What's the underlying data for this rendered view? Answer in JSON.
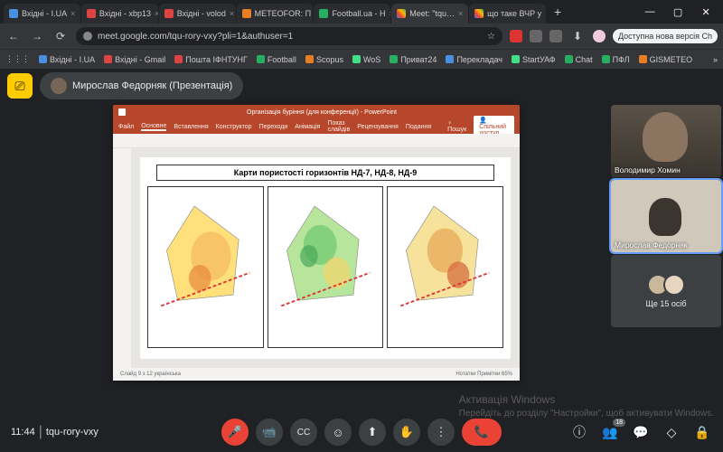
{
  "browser": {
    "tabs": [
      {
        "label": "Вхідні - I.UA",
        "close": "×"
      },
      {
        "label": "Вхідні - xbp13",
        "close": "×"
      },
      {
        "label": "Вхідні - volod",
        "close": "×"
      },
      {
        "label": "METEOFOR: П",
        "close": "×"
      },
      {
        "label": "Football.ua - Н",
        "close": "×"
      },
      {
        "label": "Meet: \"tqu…",
        "close": "×",
        "active": true
      },
      {
        "label": "що таке ВЧР у",
        "close": "×"
      }
    ],
    "new_tab": "+",
    "nav": {
      "back": "←",
      "fwd": "→",
      "reload": "⟳"
    },
    "url": "meet.google.com/tqu-rory-vxy?pli=1&authuser=1",
    "star": "☆",
    "new_version": "Доступна нова версія Ch",
    "bookmarks": [
      {
        "label": "Вхідні - I.UA"
      },
      {
        "label": "Вхідні - Gmail"
      },
      {
        "label": "Пошта ІФНТУНГ"
      },
      {
        "label": "Football"
      },
      {
        "label": "Scopus"
      },
      {
        "label": "WoS"
      },
      {
        "label": "Приват24"
      },
      {
        "label": "Перекладач"
      },
      {
        "label": "StartУАФ"
      },
      {
        "label": "Chat"
      },
      {
        "label": "ПФЛ"
      },
      {
        "label": "GISMETEO"
      }
    ],
    "apps_icon": "⋮⋮⋮",
    "more_bm": "»"
  },
  "meet": {
    "present_icon": "⎚",
    "presenter": "Мирослав Федорняк (Презентація)",
    "participants": [
      {
        "name": "Володимир Хомин"
      },
      {
        "name": "Мирослав Федорняк"
      }
    ],
    "more_count_label": "Ще 15 осіб",
    "clock": "11:44",
    "code": "tqu-rory-vxy",
    "controls": {
      "mic": "🎤",
      "cam": "📹",
      "cc": "CC",
      "react": "☺",
      "share": "⬆",
      "hand": "✋",
      "more": "⋮",
      "end": "📞"
    },
    "right": {
      "info": "ⓘ",
      "people": "👥",
      "people_badge": "18",
      "chat": "💬",
      "activities": "◇",
      "lock": "🔒"
    }
  },
  "ppt": {
    "titlebar": "Організація буріння (для конференції) - PowerPoint",
    "tabs": [
      "Файл",
      "Основне",
      "Вставлення",
      "Конструктор",
      "Переходи",
      "Анімація",
      "Показ слайдів",
      "Рецензування",
      "Подання"
    ],
    "search": "Пошук",
    "share": "Спільний доступ",
    "slide_title": "Карти пористості горизонтів НД-7, НД-8, НД-9",
    "status_left": "Слайд 9 з 12   українська",
    "status_right": "Нотатки   Примітки   65%"
  },
  "watermark": {
    "title": "Активація Windows",
    "sub": "Перейдіть до розділу \"Настройки\", щоб активувати Windows."
  }
}
